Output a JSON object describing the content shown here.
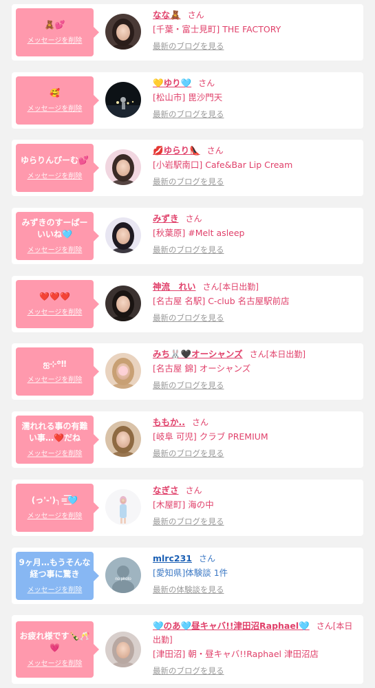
{
  "items": [
    {
      "message": "🧸💕",
      "delete_label": "メッセージを削除",
      "name": "なな🧸",
      "suffix": "さん",
      "shop": "[千葉・富士見町] THE FACTORY",
      "blog_link": "最新のブログを見る",
      "avatar_icon": "person-avatar-icon",
      "theme": "pink"
    },
    {
      "message": "🥰",
      "delete_label": "メッセージを削除",
      "name": "💛ゆり🩵",
      "suffix": "さん",
      "shop": "[松山市] 毘沙門天",
      "blog_link": "最新のブログを見る",
      "avatar_icon": "night-photo-avatar-icon",
      "theme": "pink"
    },
    {
      "message": "ゆらりんぴーむ💕",
      "delete_label": "メッセージを削除",
      "name": "💋ゆらり👠",
      "suffix": "さん",
      "shop": "[小岩駅南口] Cafe&Bar Lip Cream",
      "blog_link": "最新のブログを見る",
      "avatar_icon": "person-avatar-icon",
      "theme": "pink"
    },
    {
      "message": "みずきのすーぱーいいね🩵",
      "delete_label": "メッセージを削除",
      "name": "みずき",
      "suffix": "さん",
      "shop": "[秋葉原] #Melt asleep",
      "blog_link": "最新のブログを見る",
      "avatar_icon": "person-avatar-icon",
      "theme": "pink"
    },
    {
      "message": "❤️❤️❤️",
      "delete_label": "メッセージを削除",
      "name": "神流　れい",
      "suffix": "さん[本日出勤]",
      "shop": "[名古屋 名駅] C-club 名古屋駅前店",
      "blog_link": "最新のブログを見る",
      "avatar_icon": "person-avatar-icon",
      "theme": "pink"
    },
    {
      "message": "ஐ⊹꙳‼︎",
      "delete_label": "メッセージを削除",
      "name": "みち🐰🖤オーシャンズ",
      "suffix": "さん[本日出勤]",
      "shop": "[名古屋 錦] オーシャンズ",
      "blog_link": "最新のブログを見る",
      "avatar_icon": "person-avatar-icon",
      "theme": "pink"
    },
    {
      "message": "濡れれる事の有難い事…❤️だね",
      "delete_label": "メッセージを削除",
      "name": "ももか..",
      "suffix": "さん",
      "shop": "[岐阜 可児] クラブ PREMIUM",
      "blog_link": "最新のブログを見る",
      "avatar_icon": "person-avatar-icon",
      "theme": "pink"
    },
    {
      "message": "(っ'-')╮=͟͟͞͞🩵",
      "delete_label": "メッセージを削除",
      "name": "なぎさ",
      "suffix": "さん",
      "shop": "[木屋町] 海の中",
      "blog_link": "最新のブログを見る",
      "avatar_icon": "person-avatar-icon",
      "theme": "pink"
    },
    {
      "message": "9ヶ月…もうそんな経つ事に驚き",
      "delete_label": "メッセージを削除",
      "name": "mlrc231",
      "suffix": "さん",
      "shop": "[愛知県]体験談 1件",
      "blog_link": "最新の体験談を見る",
      "avatar_icon": "no-photo-avatar-icon",
      "theme": "blue"
    },
    {
      "message": "お疲れ様です🍾🥂💗",
      "delete_label": "メッセージを削除",
      "name": "🩵のあ🩵昼キャバ!!津田沼Raphael🩵",
      "suffix": "さん[本日出勤]",
      "shop": "[津田沼] 朝・昼キャバ!!Raphael 津田沼店",
      "blog_link": "最新のブログを見る",
      "avatar_icon": "person-avatar-icon",
      "theme": "pink"
    }
  ]
}
